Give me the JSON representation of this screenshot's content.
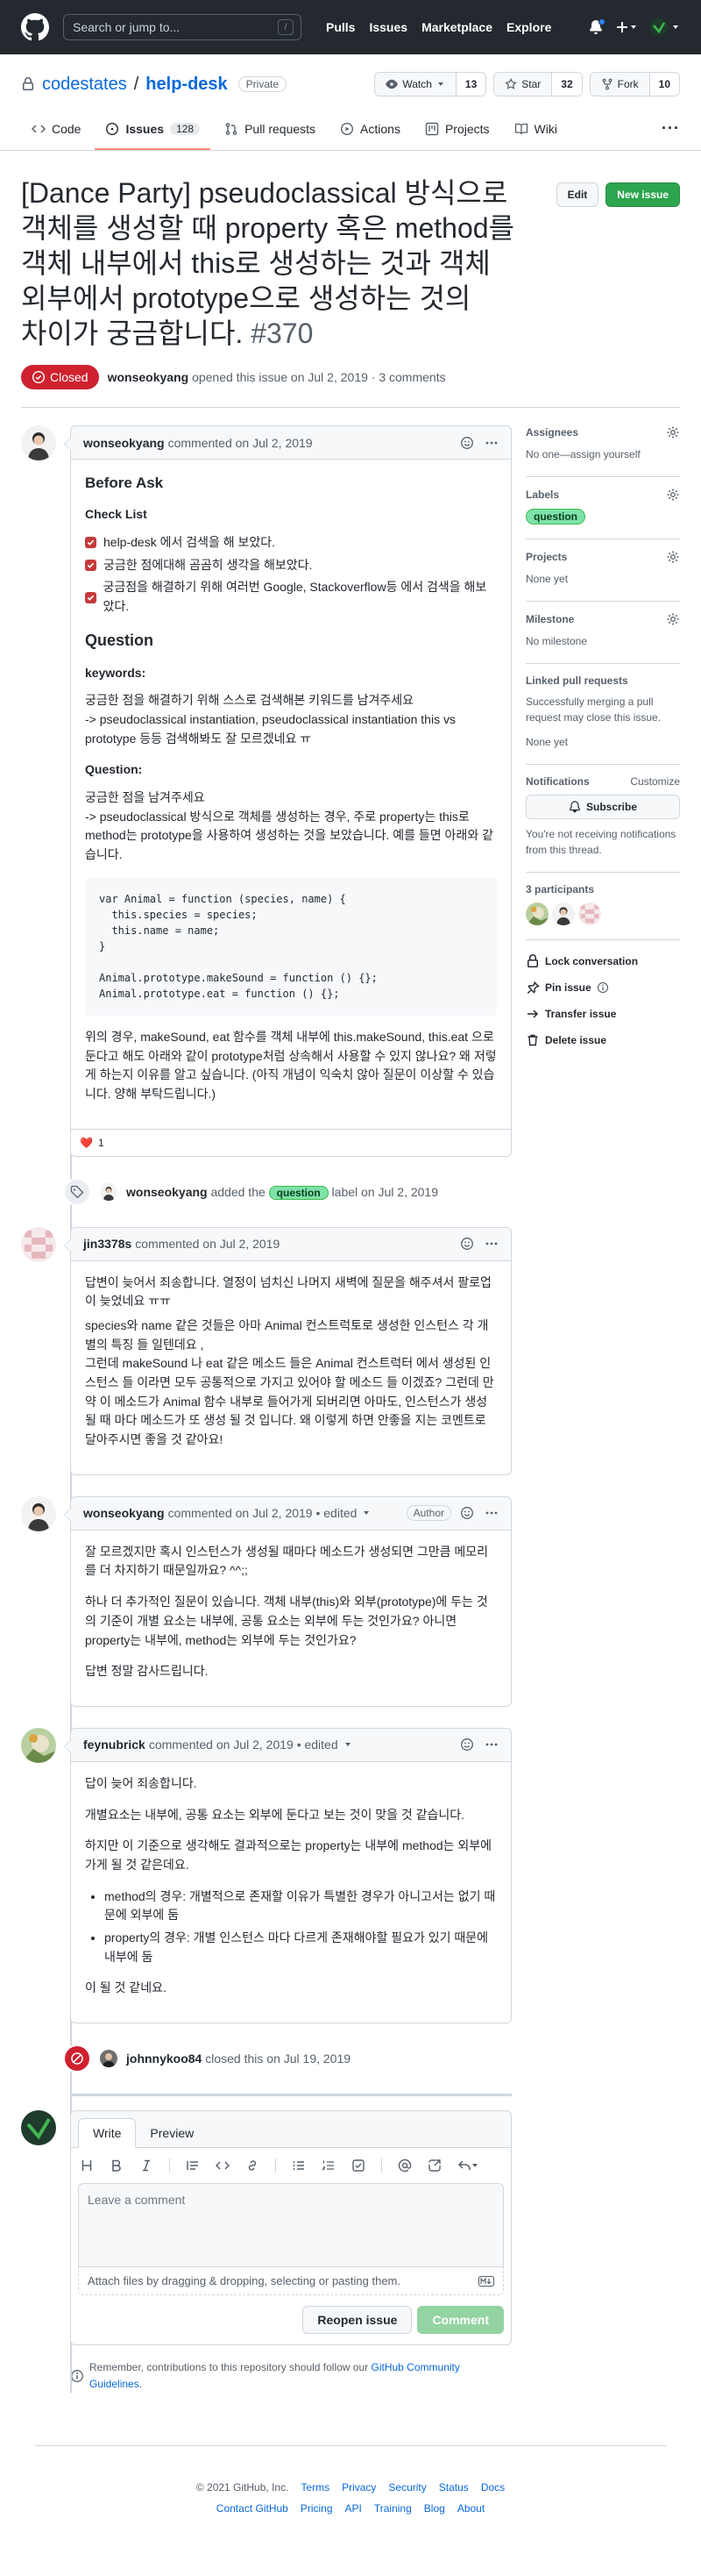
{
  "header": {
    "search_placeholder": "Search or jump to...",
    "slash": "/",
    "nav": [
      "Pulls",
      "Issues",
      "Marketplace",
      "Explore"
    ]
  },
  "repo": {
    "owner": "codestates",
    "separator": "/",
    "name": "help-desk",
    "visibility": "Private",
    "watch_label": "Watch",
    "watch_count": "13",
    "star_label": "Star",
    "star_count": "32",
    "fork_label": "Fork",
    "fork_count": "10"
  },
  "tabs": [
    {
      "label": "Code"
    },
    {
      "label": "Issues",
      "count": "128"
    },
    {
      "label": "Pull requests"
    },
    {
      "label": "Actions"
    },
    {
      "label": "Projects"
    },
    {
      "label": "Wiki"
    }
  ],
  "tab_more": "···",
  "issue": {
    "title": "[Dance Party] pseudoclassical 방식으로 객체를 생성할 때 property 혹은 method를 객체 내부에서 this로 생성하는 것과 객체 외부에서 prototype으로 생성하는 것의 차이가 궁금합니다.",
    "number": "#370",
    "edit_label": "Edit",
    "new_issue_label": "New issue",
    "status": "Closed",
    "author": "wonseokyang",
    "opened_text": "opened this issue on Jul 2, 2019 · 3 comments"
  },
  "comment1": {
    "author": "wonseokyang",
    "meta": "commented on Jul 2, 2019",
    "before_ask": "Before Ask",
    "check_list": "Check List",
    "checks": [
      "help-desk 에서 검색을 해 보았다.",
      "궁금한 점에대해 곰곰히 생각을 해보았다.",
      "궁금점을 해결하기 위해 여러번 Google, Stackoverflow등 에서 검색을 해보았다."
    ],
    "question_heading": "Question",
    "keywords_heading": "keywords:",
    "keywords_text": "궁금한 점을 해결하기 위해 스스로 검색해본 키워드를 남겨주세요\n-> pseudoclassical instantiation, pseudoclassical instantiation this vs prototype 등등 검색해봐도 잘 모르겠네요 ㅠ",
    "question_label": "Question:",
    "question_text": "궁금한 점을 남겨주세요\n-> pseudoclassical 방식으로 객체를 생성하는 경우, 주로 property는 this로 method는 prototype을 사용하여 생성하는 것을 보았습니다. 예를 들면 아래와 같습니다.",
    "code": "var Animal = function (species, name) {\n  this.species = species;\n  this.name = name;\n}\n\nAnimal.prototype.makeSound = function () {};\nAnimal.prototype.eat = function () {};",
    "closing_text": "위의 경우, makeSound, eat 함수를 객체 내부에 this.makeSound, this.eat 으로 둔다고 해도 아래와 같이 prototype처럼 상속해서 사용할 수 있지 않나요? 왜 저렇게 하는지 이유를 알고 싶습니다. (아직 개념이 익숙치 않아 질문이 이상할 수 있습니다. 양해 부탁드립니다.)",
    "reaction_emoji": "❤️",
    "reaction_count": "1"
  },
  "label_event": {
    "actor": "wonseokyang",
    "pre": "added the",
    "label": "question",
    "post": "label on Jul 2, 2019"
  },
  "comment2": {
    "author": "jin3378s",
    "meta": "commented on Jul 2, 2019",
    "p1": "답변이 늦어서 죄송합니다. 열정이 넘치신 나머지 새벽에 질문을 해주셔서 팔로업이 늦었네요 ㅠㅠ",
    "p2": "species와 name 같은 것들은 아마 Animal 컨스트럭토로 생성한 인스턴스 각 개별의 특징 들 일텐데요 ,",
    "p3": "그런데 makeSound 나 eat 같은 메소드 들은 Animal 컨스트럭터 에서 생성된 인스턴스 들 이라면 모두 공통적으로 가지고 있어야 할 메소드 들 이겠죠? 그런데 만약 이 메소드가 Animal 함수 내부로 들어가게 되버리면 아마도, 인스턴스가 생성 될 때 마다 메소드가 또 생성 될 것 입니다. 왜 이렇게 하면 안좋을 지는 코멘트로 달아주시면 좋을 것 같아요!"
  },
  "comment3": {
    "author": "wonseokyang",
    "meta": "commented on Jul 2, 2019 • edited",
    "badge": "Author",
    "p1": "잘 모르겠지만 혹시 인스턴스가 생성될 때마다 메소드가 생성되면 그만큼 메모리를 더 차지하기 때문일까요? ^^;;",
    "p2": "하나 더 추가적인 질문이 있습니다. 객체 내부(this)와 외부(prototype)에 두는 것의 기준이 개별 요소는 내부에, 공통 요소는 외부에 두는 것인가요? 아니면 property는 내부에, method는 외부에 두는 것인가요?",
    "p3": "답변 정말 감사드립니다."
  },
  "comment4": {
    "author": "feynubrick",
    "meta": "commented on Jul 2, 2019 • edited",
    "p1": "답이 늦어 죄송합니다.",
    "p2": "개별요소는 내부에, 공통 요소는 외부에 둔다고 보는 것이 맞을 것 같습니다.",
    "p3": "하지만 이 기준으로 생각해도 결과적으로는 property는 내부에 method는 외부에 가게 될 것 같은데요.",
    "li1": "method의 경우: 개별적으로 존재할 이유가 특별한 경우가 아니고서는 없기 때문에 외부에 둠",
    "li2": "property의 경우: 개별 인스턴스 마다 다르게 존재해야할 필요가 있기 때문에 내부에 둠",
    "p4": "이 될 것 같네요."
  },
  "closed_event": {
    "actor": "johnnykoo84",
    "text": "closed this on Jul 19, 2019"
  },
  "new_comment": {
    "tab_write": "Write",
    "tab_preview": "Preview",
    "placeholder": "Leave a comment",
    "attach_text": "Attach files by dragging & dropping, selecting or pasting them.",
    "reopen_label": "Reopen issue",
    "comment_label": "Comment",
    "remember_text": "Remember, contributions to this repository should follow our",
    "guidelines_link": "GitHub Community Guidelines",
    "period": "."
  },
  "sidebar": {
    "assignees_title": "Assignees",
    "assignees_value": "No one—assign yourself",
    "labels_title": "Labels",
    "labels_value": "question",
    "projects_title": "Projects",
    "projects_value": "None yet",
    "milestone_title": "Milestone",
    "milestone_value": "No milestone",
    "linked_title": "Linked pull requests",
    "linked_text": "Successfully merging a pull request may close this issue.",
    "linked_value": "None yet",
    "notifications_title": "Notifications",
    "customize_label": "Customize",
    "subscribe_label": "Subscribe",
    "notifications_text": "You're not receiving notifications from this thread.",
    "participants_title": "3 participants",
    "lock_label": "Lock conversation",
    "pin_label": "Pin issue",
    "transfer_label": "Transfer issue",
    "delete_label": "Delete issue"
  },
  "footer": {
    "copyright": "© 2021 GitHub, Inc.",
    "links1": [
      "Terms",
      "Privacy",
      "Security",
      "Status",
      "Docs"
    ],
    "links2": [
      "Contact GitHub",
      "Pricing",
      "API",
      "Training",
      "Blog",
      "About"
    ]
  },
  "colors": {
    "header_bg": "#24292f",
    "closed_red": "#cf222e",
    "green": "#2da44e",
    "link": "#0969da",
    "label_green": "#7ee2a8"
  }
}
